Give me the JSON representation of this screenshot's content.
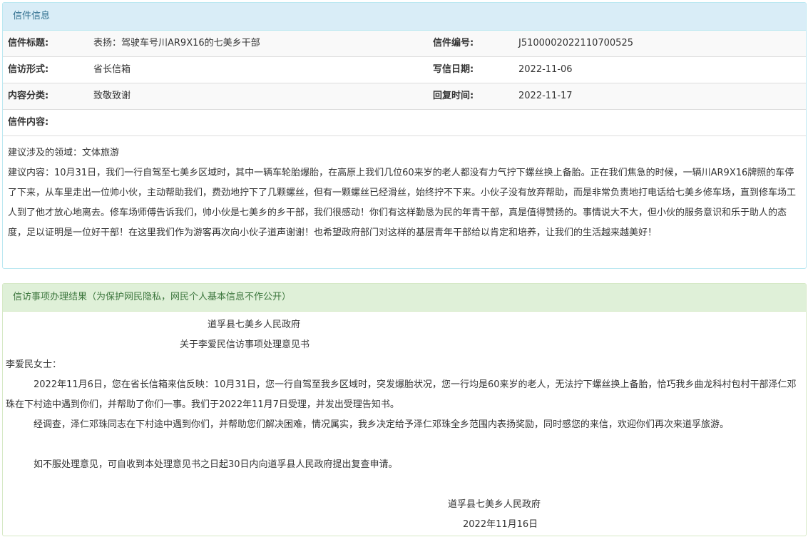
{
  "letter_panel": {
    "heading": "信件信息",
    "rows": [
      {
        "label": "信件标题:",
        "value": "表扬：驾驶车号川AR9X16的七美乡干部",
        "label2": "信件编号:",
        "value2": "J5100002022110700525"
      },
      {
        "label": "信访形式:",
        "value": "省长信箱",
        "label2": "写信日期:",
        "value2": "2022-11-06"
      },
      {
        "label": "内容分类:",
        "value": "致敬致谢",
        "label2": "回复时间:",
        "value2": "2022-11-17"
      }
    ],
    "content_label": "信件内容:",
    "content_domain": "建议涉及的领域：文体旅游",
    "content_text": "建议内容：10月31日，我们一行自驾至七美乡区域时，其中一辆车轮胎爆胎，在高原上我们几位60来岁的老人都没有力气拧下螺丝换上备胎。正在我们焦急的时候，一辆川AR9X16牌照的车停了下来，从车里走出一位帅小伙，主动帮助我们，费劲地拧下了几颗螺丝，但有一颗螺丝已经滑丝，始终拧不下来。小伙子没有放弃帮助，而是非常负责地打电话给七美乡修车场，直到修车场工人到了他才放心地离去。修车场师傅告诉我们，帅小伙是七美乡的乡干部，我们很感动！你们有这样勤恳为民的年青干部，真是值得赞扬的。事情说大不大，但小伙的服务意识和乐于助人的态度，足以证明是一位好干部！在这里我们作为游客再次向小伙子道声谢谢！也希望政府部门对这样的基层青年干部给以肯定和培养，让我们的生活越来越美好！"
  },
  "reply_panel": {
    "heading": "信访事项办理结果（为保护网民隐私，网民个人基本信息不作公开）",
    "org_title": "道孚县七美乡人民政府",
    "doc_title": "关于李爱民信访事项处理意见书",
    "salutation": "李爱民女士：",
    "para1": "　2022年11月6日，您在省长信箱来信反映：10月31日，您一行自驾至我乡区域时，突发爆胎状况，您一行均是60来岁的老人，无法拧下螺丝换上备胎，恰巧我乡曲龙科村包村干部泽仁邓珠在下村途中遇到你们，并帮助了你们一事。我们于2022年11月7日受理，并发出受理告知书。",
    "para2": "　经调查，泽仁邓珠同志在下村途中遇到你们，并帮助您们解决困难，情况属实，我乡决定给予泽仁邓珠全乡范围内表扬奖励，同时感您的来信，欢迎你们再次来道孚旅游。",
    "para3": "　如不服处理意见，可自收到本处理意见书之日起30日内向道孚县人民政府提出复查申请。",
    "signature": "道孚县七美乡人民政府",
    "date": "2022年11月16日"
  }
}
